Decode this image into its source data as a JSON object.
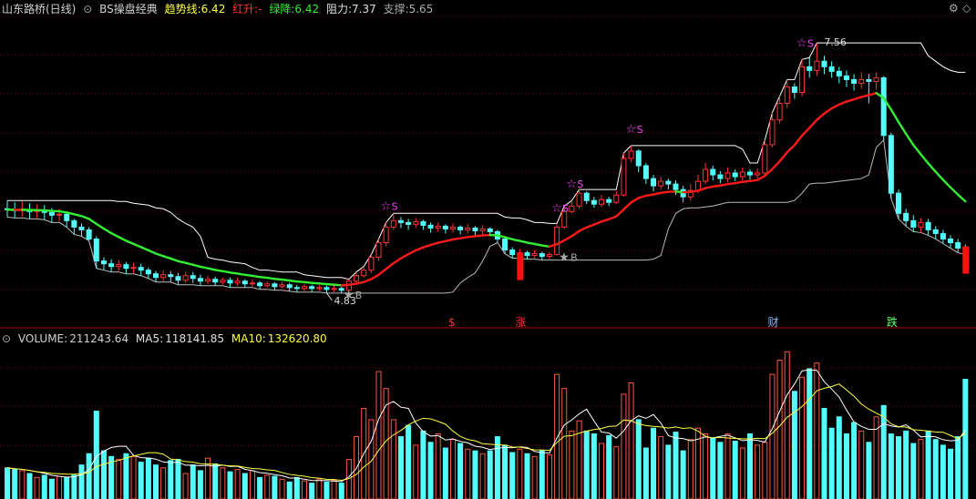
{
  "header": {
    "title": "山东路桥(日线)",
    "indicator": "BS操盘经典",
    "trend_label": "趋势线:",
    "trend_value": "6.42",
    "red_label": "红升:",
    "red_value": "-",
    "green_label": "绿降:",
    "green_value": "6.42",
    "resist_label": "阻力:",
    "resist_value": "7.37",
    "support_label": "支撑:",
    "support_value": "5.65"
  },
  "volume_header": {
    "volume_label": "VOLUME:",
    "volume_value": "211243.64",
    "ma5_label": "MA5:",
    "ma5_value": "118141.85",
    "ma10_label": "MA10:",
    "ma10_value": "132620.80"
  },
  "annotations": {
    "high_price": "7.56",
    "low_price": "4.83",
    "buy_mark": "B",
    "sell_mark": "S"
  },
  "event_tags": [
    {
      "text": "$",
      "color": "#ff3333",
      "index": 60
    },
    {
      "text": "涨",
      "color": "#ff3333",
      "index": 69
    },
    {
      "text": "财",
      "color": "#8fb8ff",
      "index": 103
    },
    {
      "text": "跌",
      "color": "#66ff66",
      "index": 119
    }
  ],
  "colors": {
    "up": "#ff3333",
    "down": "#54fcfc",
    "trend_up": "#ff1a1a",
    "trend_down": "#33ee33",
    "resistance": "#ffffff",
    "support": "#bbbbbb",
    "ma5": "#ffffff",
    "ma10": "#ffff44",
    "star": "#ff44ff",
    "grid": "#7a0000",
    "vol_up": "#ff5544",
    "vol_down": "#54fcfc"
  },
  "chart_data": {
    "type": "candlestick",
    "price_range": [
      4.55,
      7.85
    ],
    "volume_range": [
      0,
      270000
    ],
    "candles": [
      [
        5.75,
        5.74,
        5.84,
        5.66
      ],
      [
        5.74,
        5.73,
        5.82,
        5.65
      ],
      [
        5.73,
        5.74,
        5.83,
        5.66
      ],
      [
        5.74,
        5.72,
        5.81,
        5.64
      ],
      [
        5.72,
        5.73,
        5.8,
        5.65
      ],
      [
        5.73,
        5.71,
        5.79,
        5.63
      ],
      [
        5.71,
        5.68,
        5.76,
        5.6
      ],
      [
        5.68,
        5.69,
        5.75,
        5.61
      ],
      [
        5.69,
        5.62,
        5.71,
        5.55
      ],
      [
        5.62,
        5.55,
        5.64,
        5.47
      ],
      [
        5.55,
        5.52,
        5.59,
        5.45
      ],
      [
        5.52,
        5.42,
        5.55,
        5.4
      ],
      [
        5.42,
        5.18,
        5.45,
        5.1
      ],
      [
        5.18,
        5.15,
        5.22,
        5.08
      ],
      [
        5.15,
        5.12,
        5.2,
        5.06
      ],
      [
        5.12,
        5.14,
        5.19,
        5.07
      ],
      [
        5.14,
        5.1,
        5.17,
        5.04
      ],
      [
        5.1,
        5.11,
        5.16,
        5.05
      ],
      [
        5.11,
        5.08,
        5.15,
        5.02
      ],
      [
        5.08,
        5.04,
        5.11,
        4.99
      ],
      [
        5.04,
        5.0,
        5.07,
        4.95
      ],
      [
        5.0,
        5.03,
        5.08,
        4.96
      ],
      [
        5.03,
        5.01,
        5.07,
        4.95
      ],
      [
        5.01,
        4.97,
        5.05,
        4.92
      ],
      [
        4.97,
        5.02,
        5.06,
        4.94
      ],
      [
        5.02,
        4.99,
        5.06,
        4.94
      ],
      [
        4.99,
        4.96,
        5.03,
        4.91
      ],
      [
        4.96,
        4.98,
        5.02,
        4.93
      ],
      [
        4.98,
        4.95,
        5.01,
        4.91
      ],
      [
        4.95,
        4.97,
        5.0,
        4.92
      ],
      [
        4.97,
        4.94,
        5.0,
        4.89
      ],
      [
        4.94,
        4.96,
        5.0,
        4.91
      ],
      [
        4.96,
        4.93,
        4.98,
        4.89
      ],
      [
        4.93,
        4.94,
        4.98,
        4.9
      ],
      [
        4.94,
        4.91,
        4.96,
        4.87
      ],
      [
        4.91,
        4.93,
        4.96,
        4.89
      ],
      [
        4.93,
        4.9,
        4.95,
        4.86
      ],
      [
        4.9,
        4.92,
        4.95,
        4.88
      ],
      [
        4.92,
        4.89,
        4.94,
        4.85
      ],
      [
        4.89,
        4.88,
        4.92,
        4.84
      ],
      [
        4.88,
        4.9,
        4.93,
        4.85
      ],
      [
        4.9,
        4.88,
        4.92,
        4.84
      ],
      [
        4.88,
        4.89,
        4.92,
        4.85
      ],
      [
        4.89,
        4.87,
        4.91,
        4.83
      ],
      [
        4.87,
        4.88,
        4.91,
        4.84
      ],
      [
        4.88,
        4.86,
        4.9,
        4.83
      ],
      [
        4.86,
        4.96,
        4.98,
        4.84
      ],
      [
        4.96,
        5.02,
        5.06,
        4.94
      ],
      [
        5.02,
        5.08,
        5.12,
        5.0
      ],
      [
        5.08,
        5.22,
        5.25,
        5.05
      ],
      [
        5.22,
        5.38,
        5.42,
        5.18
      ],
      [
        5.38,
        5.55,
        5.6,
        5.34
      ],
      [
        5.55,
        5.62,
        5.7,
        5.52
      ],
      [
        5.62,
        5.6,
        5.66,
        5.54
      ],
      [
        5.6,
        5.58,
        5.64,
        5.52
      ],
      [
        5.58,
        5.61,
        5.65,
        5.54
      ],
      [
        5.61,
        5.57,
        5.63,
        5.52
      ],
      [
        5.57,
        5.54,
        5.6,
        5.49
      ],
      [
        5.54,
        5.56,
        5.6,
        5.5
      ],
      [
        5.56,
        5.53,
        5.58,
        5.48
      ],
      [
        5.53,
        5.55,
        5.59,
        5.49
      ],
      [
        5.55,
        5.52,
        5.57,
        5.47
      ],
      [
        5.52,
        5.54,
        5.58,
        5.48
      ],
      [
        5.54,
        5.51,
        5.56,
        5.46
      ],
      [
        5.51,
        5.53,
        5.57,
        5.47
      ],
      [
        5.53,
        5.5,
        5.55,
        5.45
      ],
      [
        5.5,
        5.42,
        5.52,
        5.38
      ],
      [
        5.42,
        5.3,
        5.44,
        5.26
      ],
      [
        5.3,
        5.25,
        5.33,
        5.21
      ],
      [
        5.25,
        5.27,
        5.31,
        5.22
      ],
      [
        5.27,
        5.24,
        5.29,
        5.2
      ],
      [
        5.24,
        5.26,
        5.3,
        5.21
      ],
      [
        5.26,
        5.23,
        5.28,
        5.19
      ],
      [
        5.23,
        5.25,
        5.28,
        5.2
      ],
      [
        5.25,
        5.55,
        5.58,
        5.24
      ],
      [
        5.55,
        5.72,
        5.78,
        5.53
      ],
      [
        5.72,
        5.78,
        5.84,
        5.7
      ],
      [
        5.78,
        5.92,
        5.96,
        5.75
      ],
      [
        5.92,
        5.84,
        5.94,
        5.8
      ],
      [
        5.84,
        5.8,
        5.88,
        5.76
      ],
      [
        5.8,
        5.85,
        5.9,
        5.77
      ],
      [
        5.85,
        5.82,
        5.88,
        5.78
      ],
      [
        5.82,
        5.9,
        5.94,
        5.8
      ],
      [
        5.9,
        6.3,
        6.36,
        5.88
      ],
      [
        6.3,
        6.38,
        6.44,
        6.26
      ],
      [
        6.38,
        6.22,
        6.4,
        6.15
      ],
      [
        6.22,
        6.08,
        6.25,
        6.02
      ],
      [
        6.08,
        6.0,
        6.12,
        5.94
      ],
      [
        6.0,
        6.05,
        6.1,
        5.96
      ],
      [
        6.05,
        6.02,
        6.08,
        5.96
      ],
      [
        6.02,
        5.96,
        6.06,
        5.9
      ],
      [
        5.96,
        5.88,
        6.0,
        5.82
      ],
      [
        5.88,
        5.95,
        6.02,
        5.84
      ],
      [
        5.95,
        6.05,
        6.12,
        5.92
      ],
      [
        6.05,
        6.18,
        6.25,
        6.02
      ],
      [
        6.18,
        6.12,
        6.22,
        6.06
      ],
      [
        6.12,
        6.08,
        6.16,
        6.03
      ],
      [
        6.08,
        6.14,
        6.2,
        6.04
      ],
      [
        6.14,
        6.1,
        6.18,
        6.05
      ],
      [
        6.1,
        6.15,
        6.2,
        6.06
      ],
      [
        6.15,
        6.12,
        6.18,
        6.07
      ],
      [
        6.12,
        6.14,
        6.19,
        6.08
      ],
      [
        6.14,
        6.45,
        6.5,
        6.12
      ],
      [
        6.45,
        6.72,
        6.8,
        6.42
      ],
      [
        6.72,
        6.9,
        6.98,
        6.68
      ],
      [
        6.9,
        7.08,
        7.16,
        6.85
      ],
      [
        7.08,
        7.02,
        7.12,
        6.95
      ],
      [
        7.02,
        7.3,
        7.38,
        6.98
      ],
      [
        7.3,
        7.26,
        7.4,
        7.18
      ],
      [
        7.26,
        7.36,
        7.56,
        7.2
      ],
      [
        7.36,
        7.3,
        7.42,
        7.22
      ],
      [
        7.3,
        7.25,
        7.36,
        7.18
      ],
      [
        7.25,
        7.2,
        7.3,
        7.12
      ],
      [
        7.2,
        7.16,
        7.26,
        7.08
      ],
      [
        7.16,
        7.12,
        7.22,
        7.04
      ],
      [
        7.12,
        7.16,
        7.24,
        7.06
      ],
      [
        7.16,
        7.14,
        7.22,
        6.9
      ],
      [
        7.14,
        7.18,
        7.24,
        7.05
      ],
      [
        7.18,
        6.55,
        7.2,
        6.5
      ],
      [
        6.55,
        5.92,
        6.58,
        5.86
      ],
      [
        5.92,
        5.7,
        5.96,
        5.64
      ],
      [
        5.7,
        5.62,
        5.75,
        5.56
      ],
      [
        5.62,
        5.55,
        5.68,
        5.5
      ],
      [
        5.55,
        5.6,
        5.65,
        5.49
      ],
      [
        5.6,
        5.52,
        5.64,
        5.46
      ],
      [
        5.52,
        5.48,
        5.56,
        5.42
      ],
      [
        5.48,
        5.42,
        5.52,
        5.37
      ],
      [
        5.42,
        5.38,
        5.46,
        5.32
      ],
      [
        5.38,
        5.32,
        5.42,
        5.27
      ],
      [
        5.32,
        5.3,
        5.36,
        5.25
      ]
    ],
    "volume": [
      55000,
      52000,
      50000,
      45000,
      38000,
      42000,
      35000,
      40000,
      38000,
      42000,
      60000,
      80000,
      155000,
      85000,
      75000,
      70000,
      80000,
      75000,
      65000,
      72000,
      60000,
      55000,
      68000,
      70000,
      45000,
      60000,
      50000,
      72000,
      62000,
      55000,
      48000,
      52000,
      45000,
      50000,
      38000,
      42000,
      40000,
      35000,
      30000,
      38000,
      32000,
      28000,
      35000,
      30000,
      33000,
      28000,
      70000,
      110000,
      160000,
      140000,
      225000,
      195000,
      140000,
      110000,
      130000,
      95000,
      120000,
      100000,
      115000,
      90000,
      105000,
      98000,
      88000,
      85000,
      80000,
      85000,
      110000,
      95000,
      82000,
      88000,
      80000,
      75000,
      85000,
      78000,
      220000,
      195000,
      120000,
      138000,
      120000,
      115000,
      98000,
      112000,
      92000,
      185000,
      205000,
      140000,
      90000,
      125000,
      110000,
      95000,
      118000,
      85000,
      105000,
      125000,
      115000,
      108000,
      100000,
      115000,
      102000,
      90000,
      115000,
      95000,
      100000,
      220000,
      245000,
      260000,
      190000,
      215000,
      230000,
      240000,
      160000,
      125000,
      145000,
      115000,
      135000,
      120000,
      100000,
      145000,
      165000,
      115000,
      110000,
      120000,
      98000,
      105000,
      120000,
      105000,
      95000,
      88000,
      110000,
      211243
    ]
  }
}
